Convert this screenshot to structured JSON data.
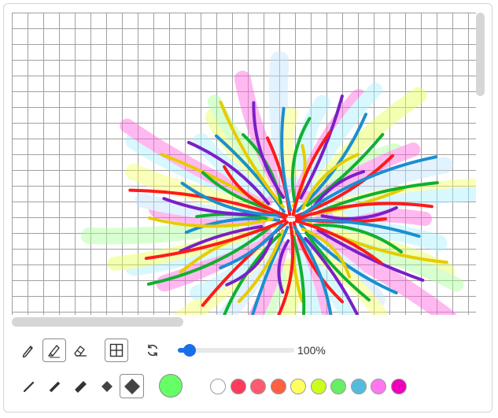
{
  "toolbar": {
    "tools": [
      {
        "name": "pencil",
        "icon": "pencil-icon",
        "active": false
      },
      {
        "name": "highlighter",
        "icon": "highlighter-icon",
        "active": true
      },
      {
        "name": "eraser",
        "icon": "eraser-icon",
        "active": false
      }
    ],
    "grid_toggle": {
      "icon": "grid-icon",
      "active": true
    },
    "reset": {
      "icon": "rotate-icon"
    },
    "zoom": {
      "value": 1.0,
      "label": "100%"
    }
  },
  "brush_sizes": {
    "options": [
      "xs",
      "s",
      "m",
      "l",
      "xl"
    ],
    "selected_index": 4
  },
  "current_color": "#66ff66",
  "palette": [
    "#ffffff",
    "#ff3b5c",
    "#ff5a70",
    "#ff6040",
    "#ffff60",
    "#ccff1a",
    "#66ee66",
    "#55bbdd",
    "#ff77ee",
    "#ee00bb"
  ]
}
